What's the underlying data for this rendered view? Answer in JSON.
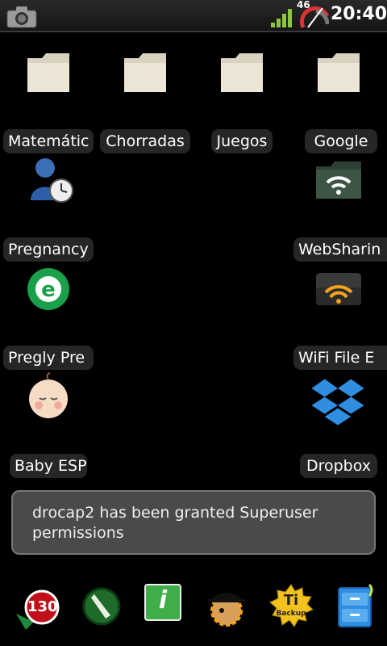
{
  "status": {
    "time": "20:40",
    "gauge_value": "46"
  },
  "desktop": {
    "items": [
      {
        "label": "Matemátic",
        "icon": "folder-icon"
      },
      {
        "label": "Chorradas",
        "icon": "folder-icon"
      },
      {
        "label": "Juegos",
        "icon": "folder-icon"
      },
      {
        "label": "Google",
        "icon": "folder-icon"
      },
      {
        "label": "Pregnancy",
        "icon": "pregnancy-person-clock-icon"
      },
      {
        "label": "WebSharin",
        "icon": "websharing-wifi-folder-icon"
      },
      {
        "label": "Pregly Pre",
        "icon": "pregly-e-icon"
      },
      {
        "label": "WiFi File E",
        "icon": "wifi-file-explorer-icon"
      },
      {
        "label": "Baby ESP",
        "icon": "baby-face-icon"
      },
      {
        "label": "Dropbox",
        "icon": "dropbox-icon"
      }
    ]
  },
  "toast": {
    "message": "drocap2 has been granted Superuser permissions"
  },
  "dock": {
    "badge": "130",
    "backup_text_top": "Ti",
    "backup_text_bottom": "Backup",
    "info_letter": "i"
  }
}
